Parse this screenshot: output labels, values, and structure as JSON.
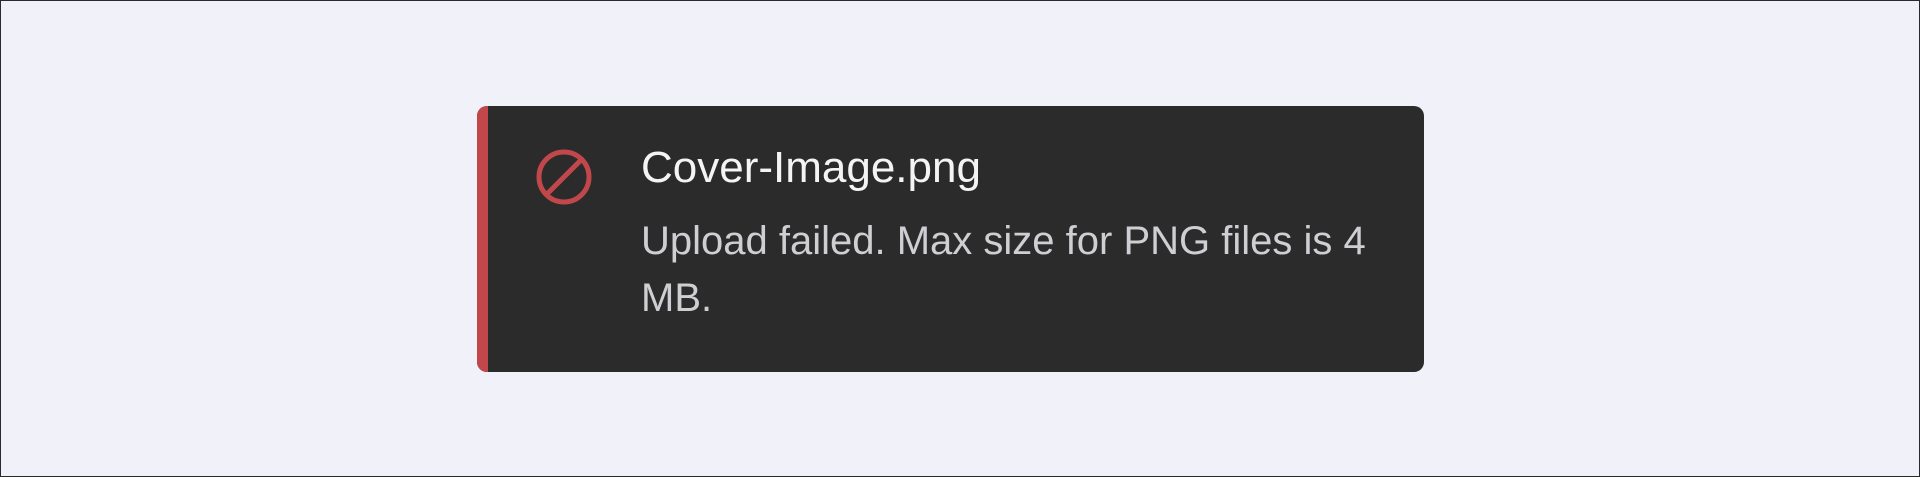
{
  "toast": {
    "icon": "prohibited-icon",
    "accent_color": "#c2474b",
    "background_color": "#2b2b2b",
    "title": "Cover-Image.png",
    "message": "Upload failed. Max size for PNG files is 4 MB."
  }
}
